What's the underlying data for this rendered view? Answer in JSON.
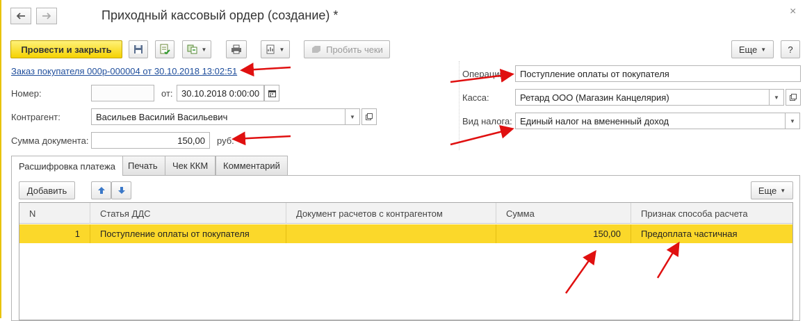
{
  "window": {
    "title": "Приходный кассовый ордер (создание) *",
    "close_glyph": "×"
  },
  "toolbar": {
    "post_close_label": "Провести и закрыть",
    "test_receipts_label": "Пробить чеки",
    "more_label": "Еще",
    "help_label": "?"
  },
  "basis_link": "Заказ покупателя 000р-000004 от 30.10.2018 13:02:51",
  "fields": {
    "number_label": "Номер:",
    "number_value": "",
    "from_label": "от:",
    "date_value": "30.10.2018  0:00:00",
    "counterparty_label": "Контрагент:",
    "counterparty_value": "Васильев Василий Васильевич",
    "amount_label": "Сумма документа:",
    "amount_value": "150,00",
    "currency": "руб.",
    "operation_label": "Операция:",
    "operation_value": "Поступление оплаты от покупателя",
    "cashbox_label": "Касса:",
    "cashbox_value": "Ретард ООО (Магазин Канцелярия)",
    "tax_label": "Вид налога:",
    "tax_value": "Единый налог на вмененный доход"
  },
  "tabs": [
    {
      "label": "Расшифровка платежа",
      "active": true
    },
    {
      "label": "Печать",
      "active": false
    },
    {
      "label": "Чек ККМ",
      "active": false
    },
    {
      "label": "Комментарий",
      "active": false
    }
  ],
  "panel": {
    "add_label": "Добавить",
    "more_label": "Еще"
  },
  "table": {
    "columns": [
      "N",
      "Статья ДДС",
      "Документ расчетов с контрагентом",
      "Сумма",
      "Признак способа расчета"
    ],
    "rows": [
      {
        "n": "1",
        "item": "Поступление оплаты от покупателя",
        "document": "",
        "sum": "150,00",
        "method": "Предоплата частичная"
      }
    ]
  },
  "colors": {
    "accent_yellow": "#f5d200",
    "row_selected": "#fbd82a",
    "link": "#1f4e9c",
    "annotation_arrow": "#e01010"
  }
}
